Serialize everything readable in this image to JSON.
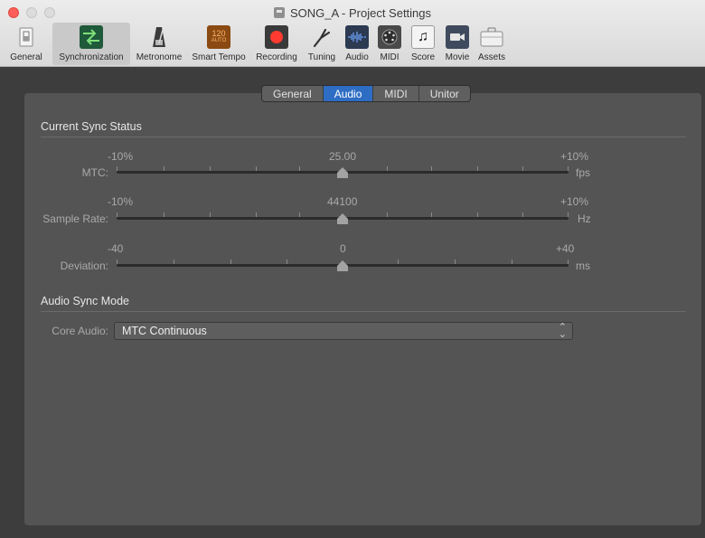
{
  "window": {
    "title": "SONG_A - Project Settings"
  },
  "toolbar": {
    "items": [
      {
        "label": "General",
        "icon": "switch-icon"
      },
      {
        "label": "Synchronization",
        "icon": "sync-arrows-icon"
      },
      {
        "label": "Metronome",
        "icon": "metronome-icon"
      },
      {
        "label": "Smart Tempo",
        "icon": "smart-tempo-icon",
        "badge_top": "120",
        "badge_bottom": "AUTO"
      },
      {
        "label": "Recording",
        "icon": "record-icon"
      },
      {
        "label": "Tuning",
        "icon": "tuning-fork-icon"
      },
      {
        "label": "Audio",
        "icon": "waveform-icon"
      },
      {
        "label": "MIDI",
        "icon": "midi-port-icon"
      },
      {
        "label": "Score",
        "icon": "music-note-icon"
      },
      {
        "label": "Movie",
        "icon": "camera-icon"
      },
      {
        "label": "Assets",
        "icon": "briefcase-icon"
      }
    ],
    "active": "Synchronization"
  },
  "tabs": {
    "items": [
      "General",
      "Audio",
      "MIDI",
      "Unitor"
    ],
    "selected": "Audio"
  },
  "current_sync_status": {
    "title": "Current Sync Status",
    "rows": [
      {
        "label": "MTC:",
        "min": "-10%",
        "value": "25.00",
        "max": "+10%",
        "unit": "fps",
        "level": 0.5
      },
      {
        "label": "Sample Rate:",
        "min": "-10%",
        "value": "44100",
        "max": "+10%",
        "unit": "Hz",
        "level": 0.5
      },
      {
        "label": "Deviation:",
        "min": "-40",
        "value": "0",
        "max": "+40",
        "unit": "ms",
        "level": 0.5
      }
    ]
  },
  "audio_sync_mode": {
    "title": "Audio Sync Mode",
    "core_audio_label": "Core Audio:",
    "core_audio_value": "MTC Continuous"
  },
  "colors": {
    "accent": "#2e6dc4",
    "record": "#ff3b30",
    "panel": "#545454"
  }
}
